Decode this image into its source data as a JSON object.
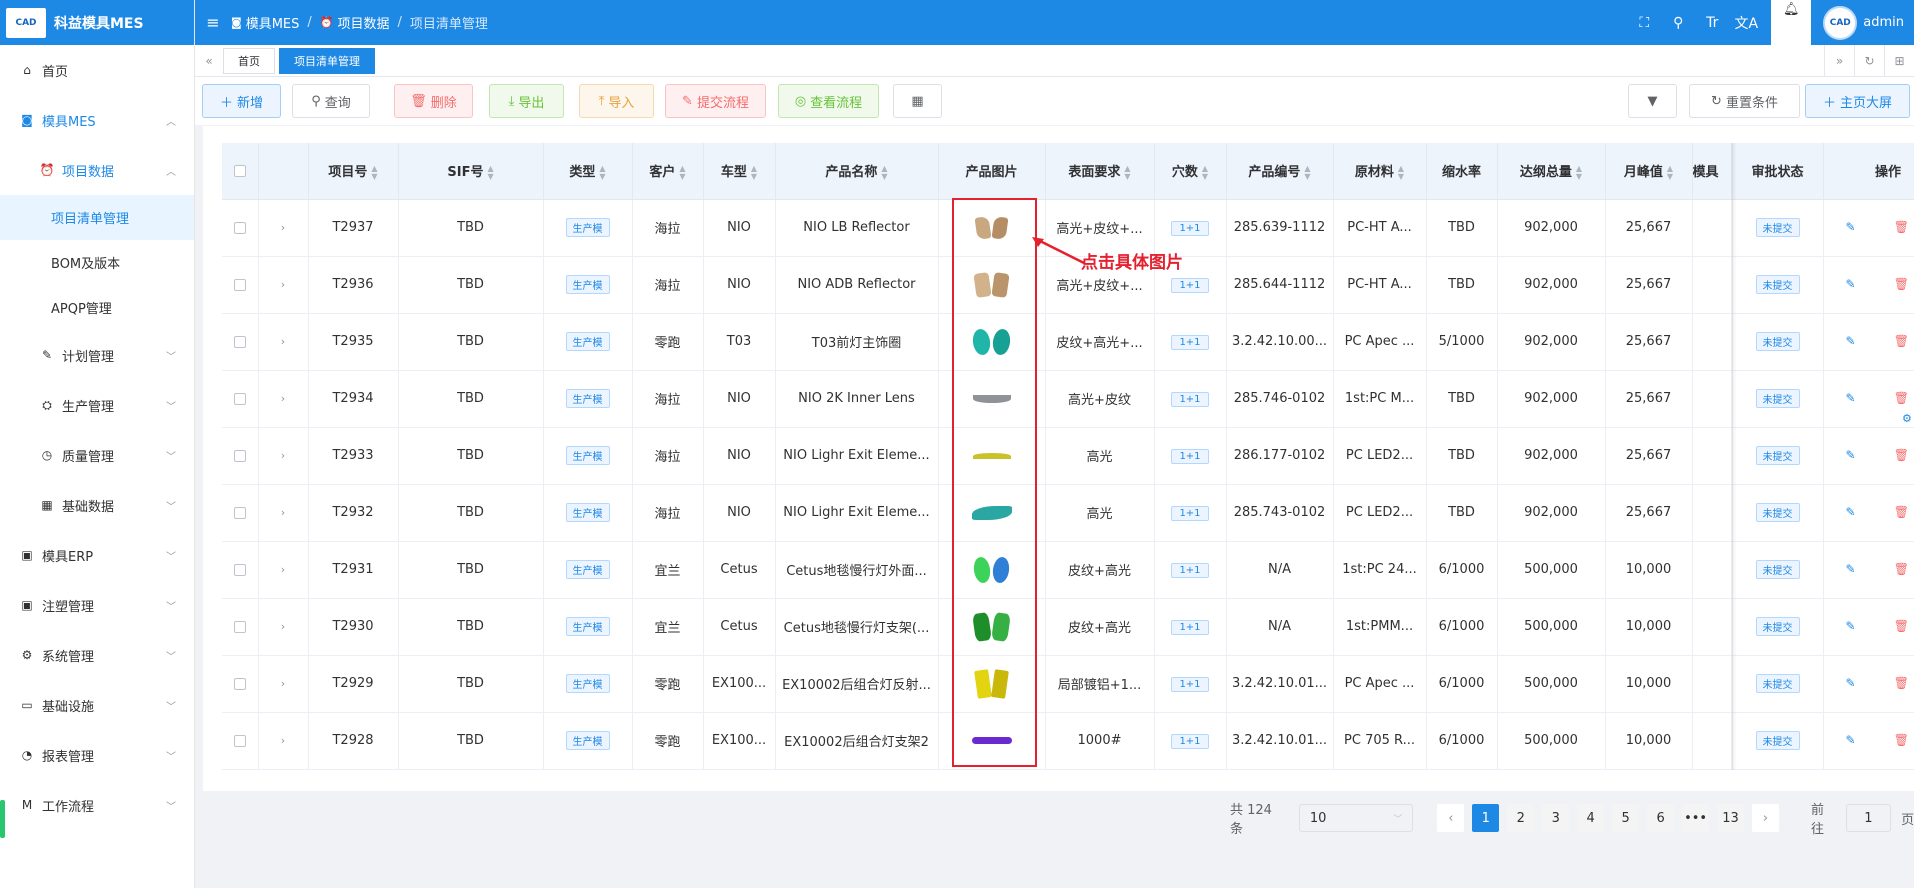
{
  "app": {
    "logo_text": "CAD",
    "title": "科益模具MES"
  },
  "sidebar": {
    "items": [
      {
        "label": "首页",
        "icon": "home-icon"
      },
      {
        "label": "模具MES",
        "icon": "camera-icon"
      },
      {
        "label": "项目数据",
        "icon": "alarm-icon"
      },
      {
        "label": "项目清单管理"
      },
      {
        "label": "BOM及版本"
      },
      {
        "label": "APQP管理"
      },
      {
        "label": "计划管理",
        "icon": "edit-icon"
      },
      {
        "label": "生产管理",
        "icon": "factory-icon"
      },
      {
        "label": "质量管理",
        "icon": "timer-icon"
      },
      {
        "label": "基础数据",
        "icon": "calendar-icon"
      },
      {
        "label": "模具ERP",
        "icon": "briefcase-icon"
      },
      {
        "label": "注塑管理",
        "icon": "briefcase-icon"
      },
      {
        "label": "系统管理",
        "icon": "gear-icon"
      },
      {
        "label": "基础设施",
        "icon": "monitor-icon"
      },
      {
        "label": "报表管理",
        "icon": "pie-icon"
      },
      {
        "label": "工作流程",
        "icon": "flow-icon"
      }
    ]
  },
  "header": {
    "breadcrumb": [
      "模具MES",
      "项目数据",
      "项目清单管理"
    ],
    "user": "admin",
    "avatar_text": "CAD"
  },
  "tabs": [
    "首页",
    "项目清单管理"
  ],
  "toolbar": {
    "add": "新增",
    "query": "查询",
    "delete": "删除",
    "export": "导出",
    "import": "导入",
    "submit_flow": "提交流程",
    "view_flow": "查看流程",
    "reset": "重置条件",
    "dashboard": "主页大屏"
  },
  "table": {
    "columns": [
      "项目号",
      "SIF号",
      "类型",
      "客户",
      "车型",
      "产品名称",
      "产品图片",
      "表面要求",
      "穴数",
      "产品编号",
      "原材料",
      "缩水率",
      "达纲总量",
      "月峰值",
      "模具",
      "审批状态",
      "操作"
    ],
    "rows": [
      {
        "no": "T2937",
        "sif": "TBD",
        "type": "生产模",
        "customer": "海拉",
        "model": "NIO",
        "name": "NIO LB Reflector",
        "surface": "高光+皮纹+...",
        "cavity": "1+1",
        "code": "285.639-1112",
        "material": "PC-HT A...",
        "shrink": "TBD",
        "total": "902,000",
        "peak": "25,667",
        "status": "未提交",
        "img": "tan"
      },
      {
        "no": "T2936",
        "sif": "TBD",
        "type": "生产模",
        "customer": "海拉",
        "model": "NIO",
        "name": "NIO ADB Reflector",
        "surface": "高光+皮纹+...",
        "cavity": "1+1",
        "code": "285.644-1112",
        "material": "PC-HT A...",
        "shrink": "TBD",
        "total": "902,000",
        "peak": "25,667",
        "status": "未提交",
        "img": "tan2"
      },
      {
        "no": "T2935",
        "sif": "TBD",
        "type": "生产模",
        "customer": "零跑",
        "model": "T03",
        "name": "T03前灯主饰圈",
        "surface": "皮纹+高光+...",
        "cavity": "1+1",
        "code": "3.2.42.10.00...",
        "material": "PC Apec ...",
        "shrink": "5/1000",
        "total": "902,000",
        "peak": "25,667",
        "status": "未提交",
        "img": "teal-rings"
      },
      {
        "no": "T2934",
        "sif": "TBD",
        "type": "生产模",
        "customer": "海拉",
        "model": "NIO",
        "name": "NIO 2K Inner Lens",
        "surface": "高光+皮纹",
        "cavity": "1+1",
        "code": "285.746-0102",
        "material": "1st:PC M...",
        "shrink": "TBD",
        "total": "902,000",
        "peak": "25,667",
        "status": "未提交",
        "img": "grey-arc"
      },
      {
        "no": "T2933",
        "sif": "TBD",
        "type": "生产模",
        "customer": "海拉",
        "model": "NIO",
        "name": "NIO Lighr Exit Eleme...",
        "surface": "高光",
        "cavity": "1+1",
        "code": "286.177-0102",
        "material": "PC LED2...",
        "shrink": "TBD",
        "total": "902,000",
        "peak": "25,667",
        "status": "未提交",
        "img": "yellow-arc"
      },
      {
        "no": "T2932",
        "sif": "TBD",
        "type": "生产模",
        "customer": "海拉",
        "model": "NIO",
        "name": "NIO Lighr Exit Eleme...",
        "surface": "高光",
        "cavity": "1+1",
        "code": "285.743-0102",
        "material": "PC LED2...",
        "shrink": "TBD",
        "total": "902,000",
        "peak": "25,667",
        "status": "未提交",
        "img": "teal-wave"
      },
      {
        "no": "T2931",
        "sif": "TBD",
        "type": "生产模",
        "customer": "宜兰",
        "model": "Cetus",
        "name": "Cetus地毯慢行灯外面...",
        "surface": "皮纹+高光",
        "cavity": "1+1",
        "code": "N/A",
        "material": "1st:PC 24...",
        "shrink": "6/1000",
        "total": "500,000",
        "peak": "10,000",
        "status": "未提交",
        "img": "green-blue"
      },
      {
        "no": "T2930",
        "sif": "TBD",
        "type": "生产模",
        "customer": "宜兰",
        "model": "Cetus",
        "name": "Cetus地毯慢行灯支架(...",
        "surface": "皮纹+高光",
        "cavity": "1+1",
        "code": "N/A",
        "material": "1st:PMM...",
        "shrink": "6/1000",
        "total": "500,000",
        "peak": "10,000",
        "status": "未提交",
        "img": "green-parts"
      },
      {
        "no": "T2929",
        "sif": "TBD",
        "type": "生产模",
        "customer": "零跑",
        "model": "EX100...",
        "name": "EX10002后组合灯反射...",
        "surface": "局部镀铝+1...",
        "cavity": "1+1",
        "code": "3.2.42.10.01...",
        "material": "PC Apec ...",
        "shrink": "6/1000",
        "total": "500,000",
        "peak": "10,000",
        "status": "未提交",
        "img": "yellow-parts"
      },
      {
        "no": "T2928",
        "sif": "TBD",
        "type": "生产模",
        "customer": "零跑",
        "model": "EX100...",
        "name": "EX10002后组合灯支架2",
        "surface": "1000#",
        "cavity": "1+1",
        "code": "3.2.42.10.01...",
        "material": "PC 705 R...",
        "shrink": "6/1000",
        "total": "500,000",
        "peak": "10,000",
        "status": "未提交",
        "img": "purple-parts"
      }
    ]
  },
  "annotation": {
    "text": "点击具体图片",
    "color": "#e5212f"
  },
  "pagination": {
    "total": "共 124 条",
    "page_size": "10",
    "pages": [
      "1",
      "2",
      "3",
      "4",
      "5",
      "6",
      "•••",
      "13"
    ],
    "current": "1",
    "goto_label": "前往",
    "goto_value": "1",
    "page_suffix": "页"
  },
  "colors": {
    "primary": "#1e88e5",
    "danger": "#f56c6c"
  }
}
